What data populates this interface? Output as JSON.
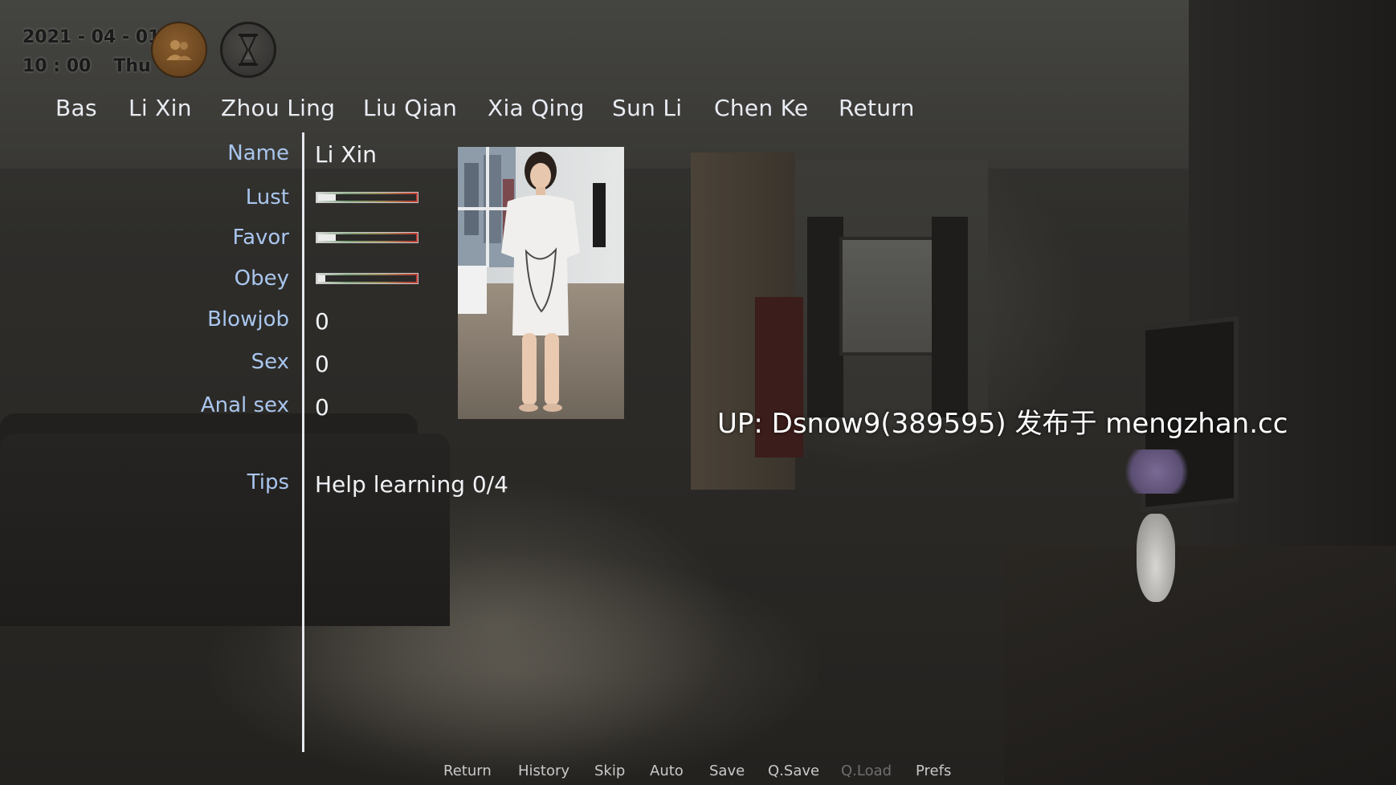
{
  "hud": {
    "date": "2021 - 04 - 01",
    "time": "10 : 00",
    "weekday": "Thu",
    "icons": {
      "contacts": "contacts-icon",
      "wait": "hourglass-icon"
    }
  },
  "tabs": [
    {
      "label": "Bas"
    },
    {
      "label": "Li Xin"
    },
    {
      "label": "Zhou Ling"
    },
    {
      "label": "Liu Qian"
    },
    {
      "label": "Xia Qing"
    },
    {
      "label": "Sun Li"
    },
    {
      "label": "Chen Ke"
    },
    {
      "label": "Return"
    }
  ],
  "stats": {
    "name_label": "Name",
    "name_value": "Li Xin",
    "lust_label": "Lust",
    "lust_level": 0.18,
    "favor_label": "Favor",
    "favor_level": 0.18,
    "obey_label": "Obey",
    "obey_level": 0.07,
    "blowjob_label": "Blowjob",
    "blowjob_value": "0",
    "sex_label": "Sex",
    "sex_value": "0",
    "anal_label": "Anal sex",
    "anal_value": "0",
    "tips_label": "Tips",
    "tips_value": "Help learning 0/4"
  },
  "watermark": "UP: Dsnow9(389595) 发布于 mengzhan.cc",
  "quick_menu": [
    {
      "label": "Return",
      "enabled": true
    },
    {
      "label": "History",
      "enabled": true
    },
    {
      "label": "Skip",
      "enabled": true
    },
    {
      "label": "Auto",
      "enabled": true
    },
    {
      "label": "Save",
      "enabled": true
    },
    {
      "label": "Q.Save",
      "enabled": true
    },
    {
      "label": "Q.Load",
      "enabled": false
    },
    {
      "label": "Prefs",
      "enabled": true
    }
  ],
  "colors": {
    "label": "#a9c6ee",
    "value": "#f0f2f5",
    "tab": "#e8ecf2",
    "quick_menu_disabled": "#6e6e6e"
  }
}
